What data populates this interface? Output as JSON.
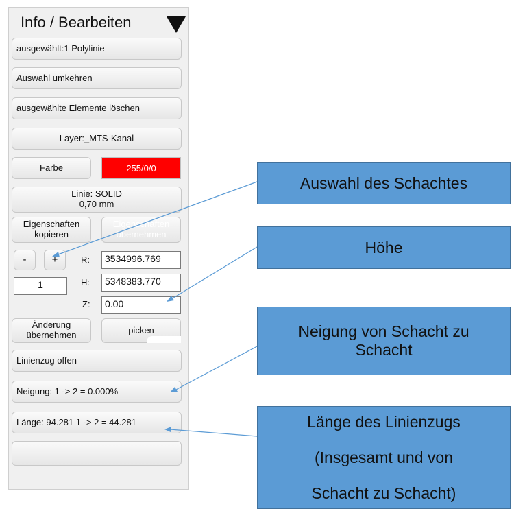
{
  "panel": {
    "title": "Info / Bearbeiten",
    "selected": "ausgewählt:1 Polylinie",
    "invert_selection": "Auswahl umkehren",
    "delete_selected": "ausgewählte Elemente löschen",
    "layer": "Layer:_MTS-Kanal",
    "color_label": "Farbe",
    "color_value": "255/0/0",
    "line_type": "Linie: SOLID",
    "line_width": "0,70 mm",
    "copy_props_1": "Eigenschaften",
    "copy_props_2": "kopieren",
    "apply_props_1": "Eigenschaften",
    "apply_props_2": "übernehmen",
    "minus": "-",
    "plus": "+",
    "index_value": "1",
    "r_label": "R:",
    "r_value": "3534996.769",
    "h_label": "H:",
    "h_value": "5348383.770",
    "z_label": "Z:",
    "z_value": "0.00",
    "apply_change_1": "Änderung",
    "apply_change_2": "übernehmen",
    "pick": "picken",
    "polyline_open": "Linienzug offen",
    "slope": "Neigung: 1 -> 2 = 0.000%",
    "length": "Länge: 94.281  1 -> 2 = 44.281",
    "empty": ""
  },
  "callouts": {
    "shaft_selection": "Auswahl des Schachtes",
    "height": "Höhe",
    "slope_1": "Neigung von Schacht zu",
    "slope_2": "Schacht",
    "length_1": "Länge des Linienzugs",
    "length_2": "(Insgesamt und von",
    "length_3": "Schacht zu Schacht)"
  },
  "colors": {
    "callout_fill": "#5b9bd5",
    "callout_border": "#41719c",
    "color_swatch": "#ff0000",
    "leader_line": "#5b9bd5"
  }
}
